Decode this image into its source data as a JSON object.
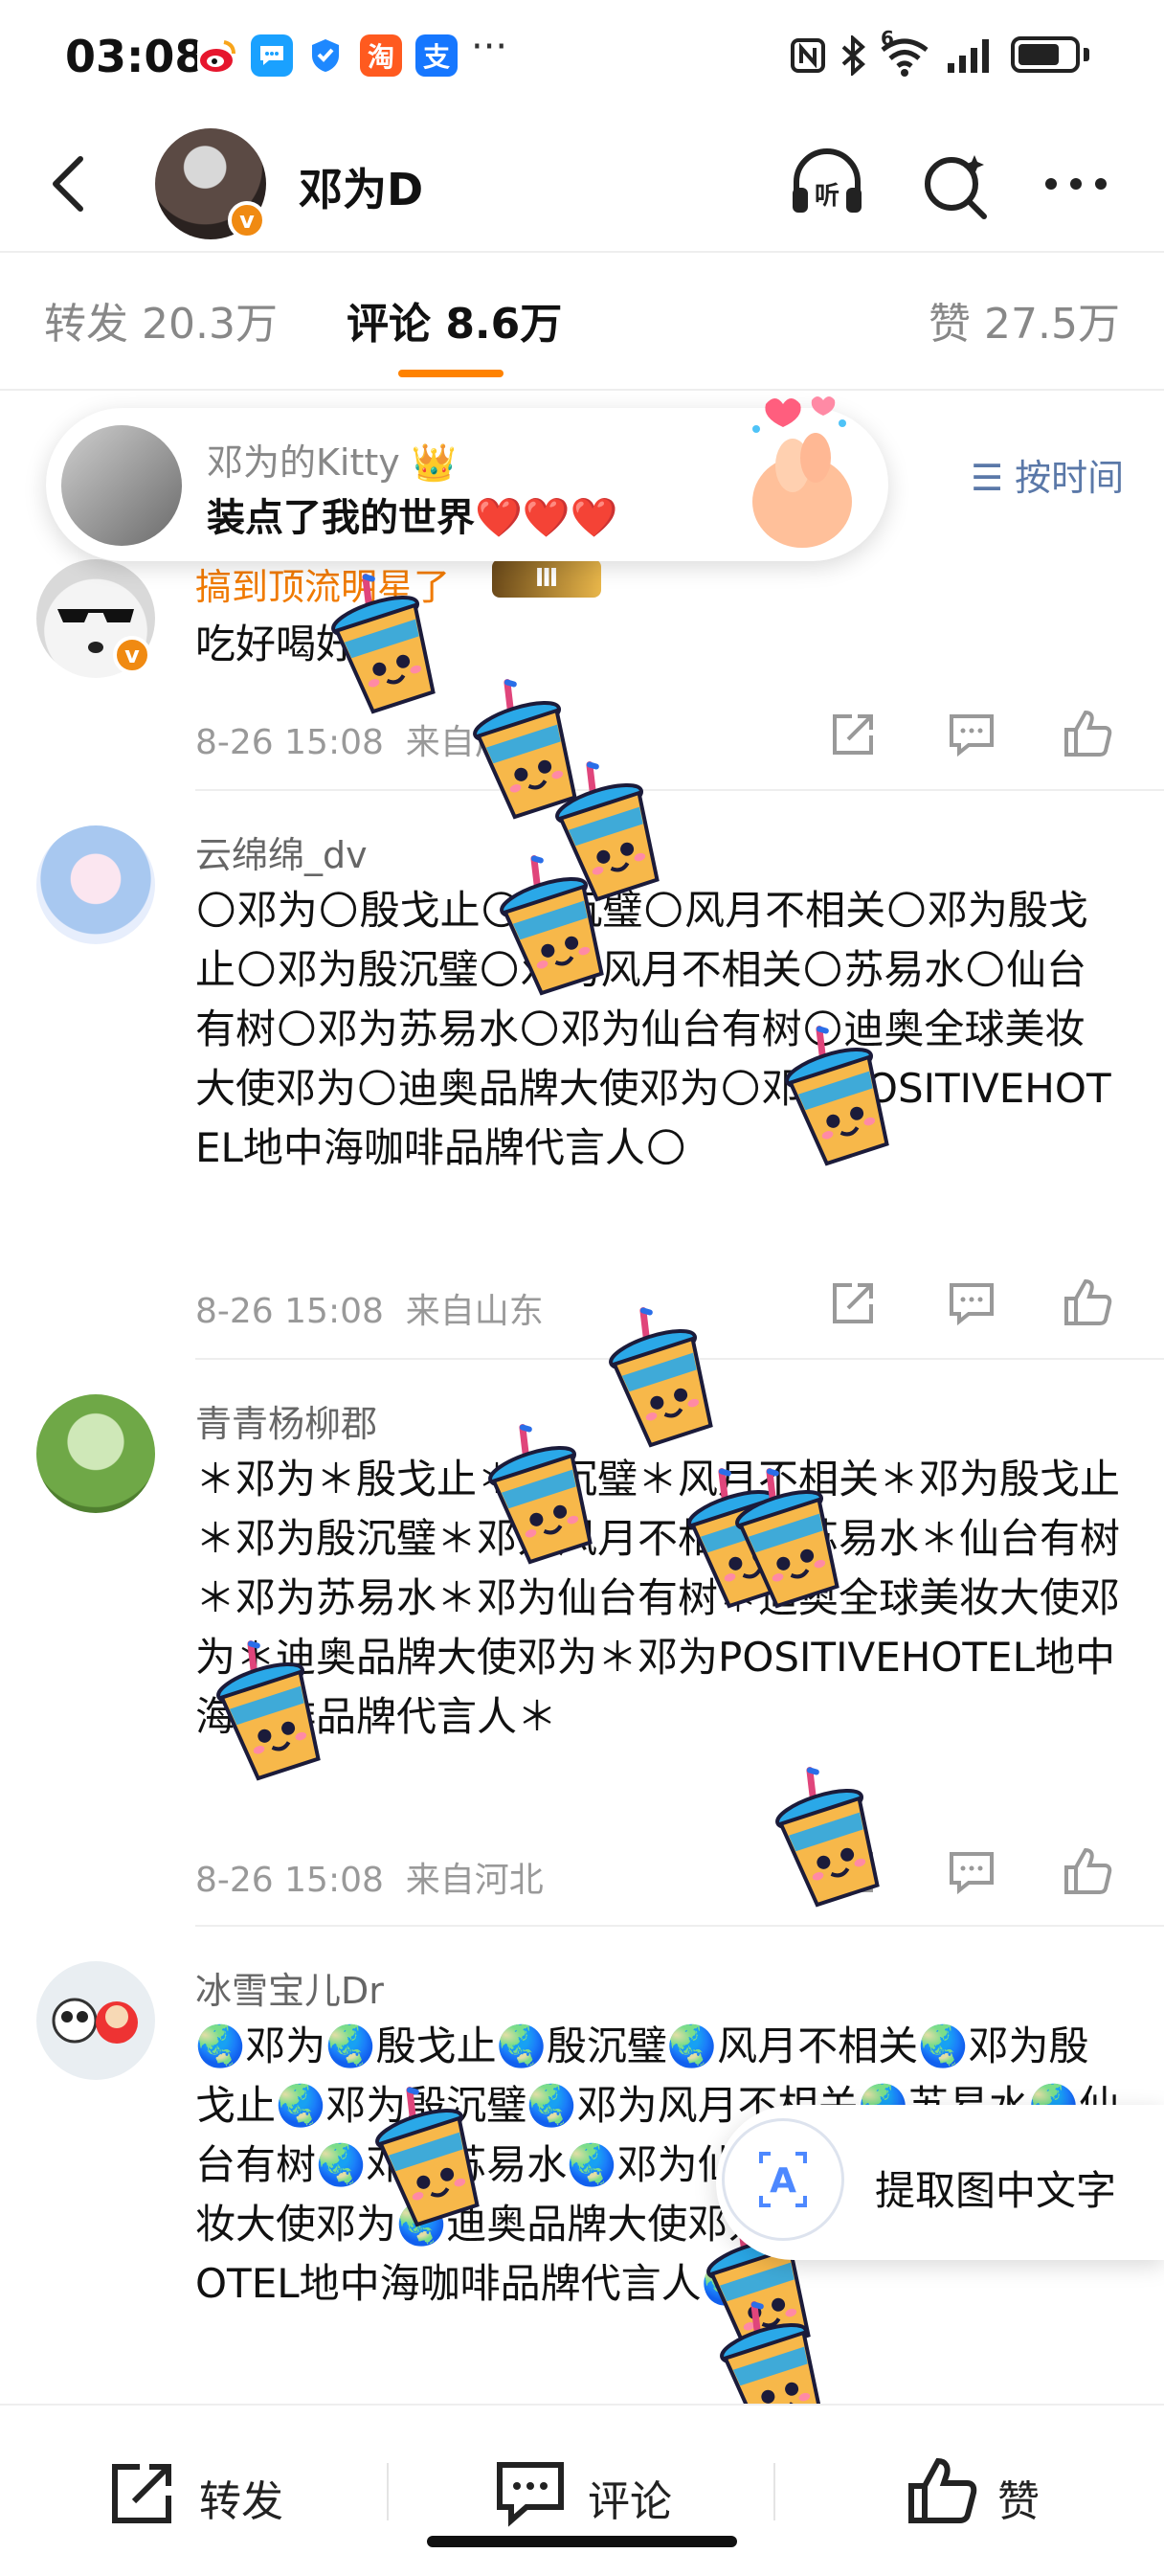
{
  "status_bar": {
    "time": "03:08",
    "app_icons": [
      "weibo-icon",
      "message-icon",
      "shield-icon",
      "taobao-icon",
      "alipay-icon"
    ],
    "more": "···",
    "taobao_glyph": "淘",
    "alipay_glyph": "支",
    "wifi_label": "6",
    "right_icons": [
      "nfc-icon",
      "bluetooth-icon",
      "wifi-icon",
      "signal-icon",
      "battery-icon"
    ],
    "battery_level": 0.75
  },
  "header": {
    "name": "邓为D",
    "listen_glyph": "听"
  },
  "tabs": [
    {
      "label": "转发 20.3万"
    },
    {
      "label": "评论 8.6万"
    },
    {
      "label": "赞 27.5万"
    }
  ],
  "gift_popup": {
    "user": "邓为的Kitty",
    "text": "装点了我的世界❤️❤️❤️"
  },
  "sort_label": "按时间",
  "comments": [
    {
      "user": "搞到顶流明星了",
      "level_badge": "Ⅲ",
      "text": "吃好喝好",
      "time": "8-26 15:08",
      "location": "来自广"
    },
    {
      "user": "云绵绵_dv",
      "text": "🌕邓为🌕殷戈止🌕殷沉璧🌕风月不相关🌕邓为殷戈止🌕邓为殷沉璧🌕邓为风月不相关🌕苏易水🌕仙台有树🌕邓为苏易水🌕邓为仙台有树🌕迪奥全球美妆大使邓为🌕迪奥品牌大使邓为🌕邓为POSITIVEHOTEL地中海咖啡品牌代言人🌕",
      "time": "8-26 15:08",
      "location": "来自山东"
    },
    {
      "user": "青青杨柳郡",
      "text": "＊邓为＊殷戈止＊殷沉璧＊风月不相关＊邓为殷戈止＊邓为殷沉璧＊邓为风月不相关＊苏易水＊仙台有树＊邓为苏易水＊邓为仙台有树＊迪奥全球美妆大使邓为＊迪奥品牌大使邓为＊邓为POSITIVEHOTEL地中海咖啡品牌代言人＊",
      "time": "8-26 15:08",
      "location": "来自河北"
    },
    {
      "user": "冰雪宝儿Dr",
      "text": "🌏邓为🌏殷戈止🌏殷沉璧🌏风月不相关🌏邓为殷戈止🌏邓为殷沉璧🌏邓为风月不相关🌏苏易水🌏仙台有树🌏邓为苏易水🌏邓为仙台有树🌏迪奥全球美妆大使邓为🌏迪奥品牌大使邓为🌏邓为POSITIVEHOTEL地中海咖啡品牌代言人🌏"
    }
  ],
  "ocr_button": "提取图中文字",
  "bottom_bar": {
    "repost": "转发",
    "comment": "评论",
    "like": "赞"
  },
  "colors": {
    "accent": "#ff8200",
    "verified": "#f08a12",
    "link_blue": "#5a78a8"
  }
}
